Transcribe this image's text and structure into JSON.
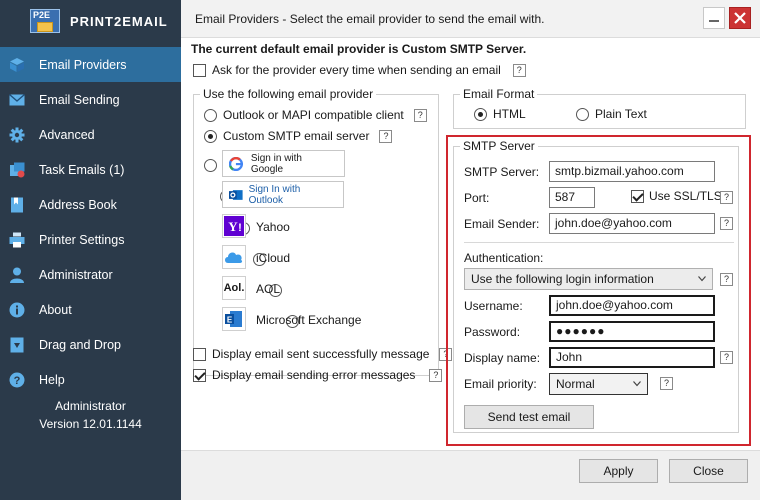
{
  "app": {
    "logo_text": "PRINT2EMAIL",
    "logo_badge": "P2E"
  },
  "sidebar": {
    "items": [
      {
        "label": "Email Providers",
        "icon": "cube-icon"
      },
      {
        "label": "Email Sending",
        "icon": "envelope-icon"
      },
      {
        "label": "Advanced",
        "icon": "gear-icon"
      },
      {
        "label": "Task Emails (1)",
        "icon": "task-icon"
      },
      {
        "label": "Address Book",
        "icon": "book-icon"
      },
      {
        "label": "Printer Settings",
        "icon": "printer-icon"
      },
      {
        "label": "Administrator",
        "icon": "user-icon"
      },
      {
        "label": "About",
        "icon": "info-icon"
      },
      {
        "label": "Drag and Drop",
        "icon": "drop-icon"
      },
      {
        "label": "Help",
        "icon": "help-icon"
      }
    ],
    "footer_user": "Administrator",
    "footer_version": "Version 12.01.1144"
  },
  "window": {
    "title": "Email Providers - Select the email provider to send the email with."
  },
  "main": {
    "default_provider_text": "The current default email provider is Custom SMTP Server.",
    "ask_provider_label": "Ask for the provider every time when sending an email",
    "providers_group_label": "Use the following email provider",
    "provider_outlook": "Outlook or MAPI compatible client",
    "provider_custom": "Custom SMTP email server",
    "provider_google": "Sign in with Google",
    "provider_outlook_signin": "Sign In with Outlook",
    "provider_yahoo": "Yahoo",
    "provider_icloud": "iCloud",
    "provider_aol": "AOL",
    "provider_aol_badge": "Aol.",
    "provider_exchange": "Microsoft Exchange",
    "display_sent_label": "Display email sent successfully message",
    "display_error_label": "Display email sending error messages",
    "format_group_label": "Email Format",
    "format_html": "HTML",
    "format_plain": "Plain Text",
    "smtp": {
      "group_label": "SMTP Server",
      "server_label": "SMTP Server:",
      "server_value": "smtp.bizmail.yahoo.com",
      "port_label": "Port:",
      "port_value": "587",
      "ssl_label": "Use SSL/TLS",
      "sender_label": "Email Sender:",
      "sender_value": "john.doe@yahoo.com",
      "auth_label": "Authentication:",
      "auth_value": "Use the following login information",
      "username_label": "Username:",
      "username_value": "john.doe@yahoo.com",
      "password_label": "Password:",
      "password_value": "●●●●●●",
      "display_name_label": "Display name:",
      "display_name_value": "John",
      "priority_label": "Email priority:",
      "priority_value": "Normal",
      "test_button": "Send test email"
    },
    "help_glyph": "?",
    "apply_button": "Apply",
    "close_button": "Close"
  },
  "colors": {
    "sidebar_bg": "#2b3a4a",
    "sidebar_active": "#2d6e9e",
    "highlight_border": "#d0262e"
  }
}
